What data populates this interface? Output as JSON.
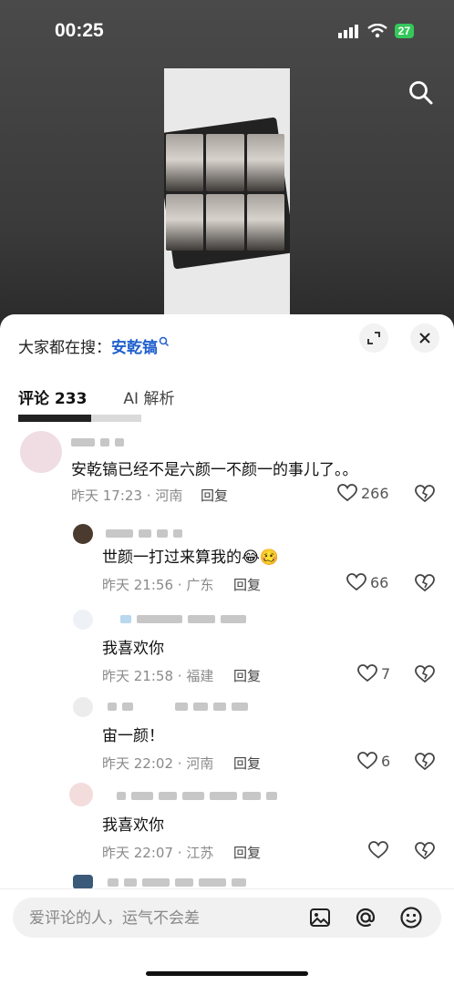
{
  "status_bar": {
    "time": "00:25",
    "battery": "27"
  },
  "hot_search": {
    "prefix": "大家都在搜：",
    "keyword": "安乾镐"
  },
  "tabs": [
    {
      "label": "评论 233"
    },
    {
      "label": "AI 解析"
    }
  ],
  "comments": [
    {
      "text": "安乾镐已经不是六颜一不颜一的事儿了。。",
      "time": "昨天 17:23",
      "location": "河南",
      "reply": "回复",
      "likes": "266"
    },
    {
      "text": "世颜一打过来算我的😂🥴",
      "time": "昨天 21:56",
      "location": "广东",
      "reply": "回复",
      "likes": "66"
    },
    {
      "text": "我喜欢你",
      "time": "昨天 21:58",
      "location": "福建",
      "reply": "回复",
      "likes": "7"
    },
    {
      "text": "宙一颜！",
      "time": "昨天 22:02",
      "location": "河南",
      "reply": "回复",
      "likes": "6"
    },
    {
      "text": "我喜欢你",
      "time": "昨天 22:07",
      "location": "江苏",
      "reply": "回复",
      "likes": ""
    }
  ],
  "input": {
    "placeholder": "爱评论的人，运气不会差"
  },
  "colors": {
    "keyword": "#1f5fcc",
    "battery": "#34c759"
  }
}
